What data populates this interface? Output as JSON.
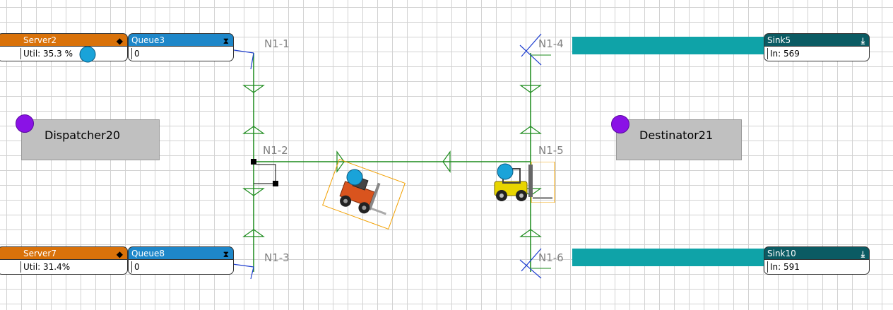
{
  "blocks": {
    "server2": {
      "title": "Server2",
      "label": "Util:",
      "value": "35.3 %"
    },
    "queue3": {
      "title": "Queue3",
      "value": "0"
    },
    "sink5": {
      "title": "Sink5",
      "label": "In:",
      "value": "569"
    },
    "server7": {
      "title": "Server7",
      "label": "Util:",
      "value": "31.4%"
    },
    "queue8": {
      "title": "Queue8",
      "value": "0"
    },
    "sink10": {
      "title": "Sink10",
      "label": "In:",
      "value": "591"
    }
  },
  "controls": {
    "dispatcher": "Dispatcher20",
    "destinator": "Destinator21"
  },
  "nodes": {
    "n1_1": "N1-1",
    "n1_2": "N1-2",
    "n1_3": "N1-3",
    "n1_4": "N1-4",
    "n1_5": "N1-5",
    "n1_6": "N1-6"
  },
  "colors": {
    "server": "#d9720a",
    "queue": "#1e87c9",
    "sink": "#0b5b63",
    "conveyor": "#0fa3a8",
    "path": "#1a8a1a",
    "connector": "#1f3fd0",
    "dot_blue": "#1aa3d9",
    "dot_purple": "#8a12e6"
  },
  "icons": [
    "server-icon",
    "queue-icon",
    "sink-icon",
    "forklift-icon",
    "entity-dot-icon"
  ]
}
